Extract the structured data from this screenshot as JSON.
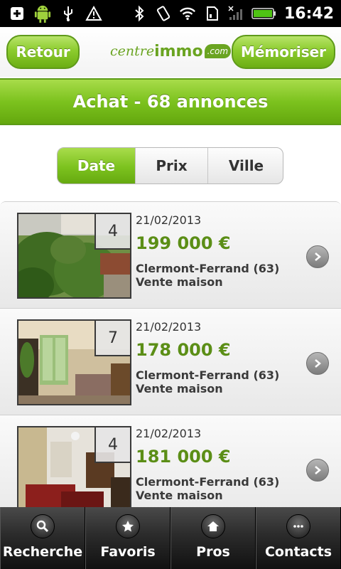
{
  "status_bar": {
    "time": "16:42",
    "icons": [
      "add-icon",
      "android-icon",
      "usb-icon",
      "warning-icon",
      "bluetooth-icon",
      "vibrate-icon",
      "wifi-icon",
      "sd-card-icon",
      "no-signal-icon",
      "battery-icon"
    ]
  },
  "header": {
    "back_label": "Retour",
    "save_label": "Mémoriser",
    "logo": {
      "part1": "centre",
      "part2": "immo",
      "part3": ".com"
    }
  },
  "banner": {
    "title": "Achat - 68 annonces"
  },
  "sort": {
    "options": [
      "Date",
      "Prix",
      "Ville"
    ],
    "selected": "Date"
  },
  "listings": [
    {
      "photo_count": "4",
      "date": "21/02/2013",
      "price": "199 000 €",
      "city": "Clermont-Ferrand (63)",
      "type": "Vente maison"
    },
    {
      "photo_count": "7",
      "date": "21/02/2013",
      "price": "178 000 €",
      "city": "Clermont-Ferrand (63)",
      "type": "Vente maison"
    },
    {
      "photo_count": "4",
      "date": "21/02/2013",
      "price": "181 000 €",
      "city": "Clermont-Ferrand (63)",
      "type": "Vente maison"
    }
  ],
  "tabbar": {
    "items": [
      {
        "label": "Recherche",
        "icon": "search-icon"
      },
      {
        "label": "Favoris",
        "icon": "star-icon"
      },
      {
        "label": "Pros",
        "icon": "home-icon"
      },
      {
        "label": "Contacts",
        "icon": "more-icon"
      }
    ]
  },
  "colors": {
    "accent": "#7cc21e",
    "price": "#5b8e16",
    "dark": "#111111"
  }
}
